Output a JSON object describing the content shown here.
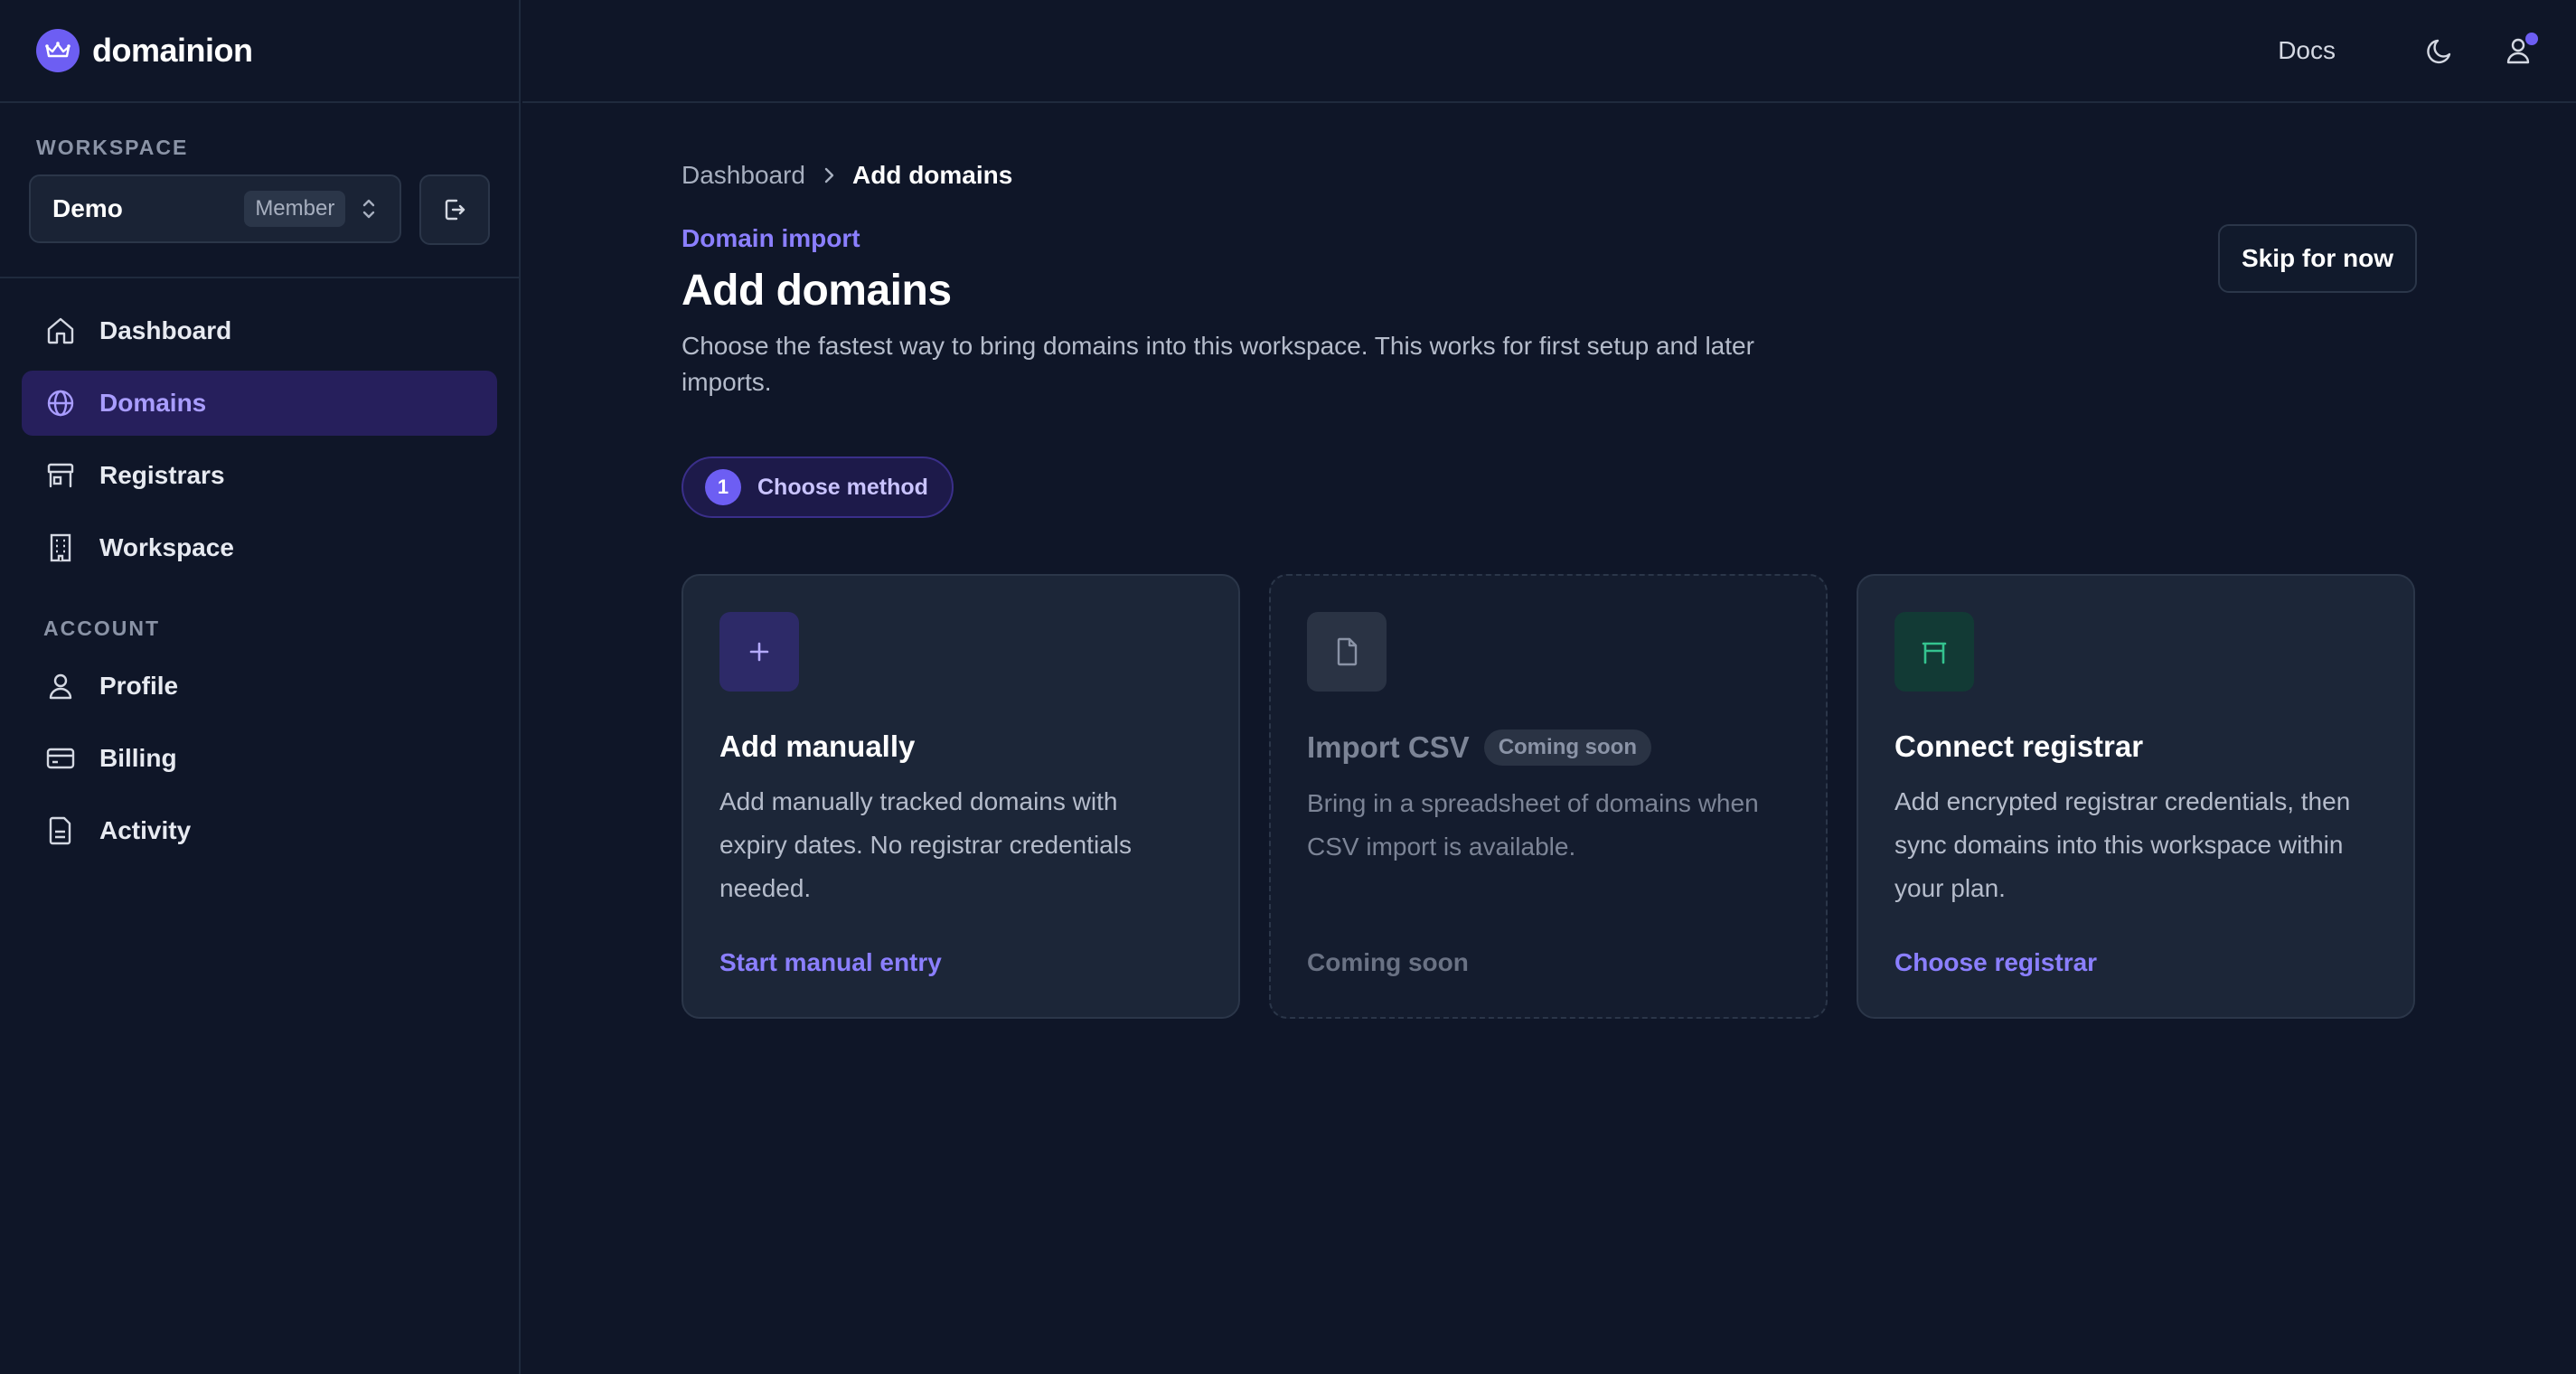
{
  "brand": {
    "name": "domainion"
  },
  "topbar": {
    "docs_label": "Docs"
  },
  "workspace": {
    "section_label": "WORKSPACE",
    "name": "Demo",
    "role": "Member"
  },
  "nav": {
    "items": [
      {
        "label": "Dashboard",
        "icon": "home-icon"
      },
      {
        "label": "Domains",
        "icon": "globe-icon",
        "active": true
      },
      {
        "label": "Registrars",
        "icon": "registrar-icon"
      },
      {
        "label": "Workspace",
        "icon": "building-icon"
      }
    ],
    "account_label": "ACCOUNT",
    "account_items": [
      {
        "label": "Profile",
        "icon": "user-icon"
      },
      {
        "label": "Billing",
        "icon": "credit-card-icon"
      },
      {
        "label": "Activity",
        "icon": "document-icon"
      }
    ]
  },
  "breadcrumb": {
    "parent": "Dashboard",
    "current": "Add domains"
  },
  "header": {
    "eyebrow": "Domain import",
    "title": "Add domains",
    "description": "Choose the fastest way to bring domains into this workspace. This works for first setup and later imports.",
    "skip_label": "Skip for now"
  },
  "step": {
    "number": "1",
    "label": "Choose method"
  },
  "cards": [
    {
      "title": "Add manually",
      "description": "Add manually tracked domains with expiry dates. No registrar credentials needed.",
      "action": "Start manual entry",
      "icon": "plus-icon"
    },
    {
      "title": "Import CSV",
      "badge": "Coming soon",
      "description": "Bring in a spreadsheet of domains when CSV import is available.",
      "action": "Coming soon",
      "icon": "file-icon",
      "disabled": true
    },
    {
      "title": "Connect registrar",
      "description": "Add encrypted registrar credentials, then sync domains into this workspace within your plan.",
      "action": "Choose registrar",
      "icon": "registrar-icon"
    }
  ],
  "colors": {
    "background": "#0f1628",
    "accent": "#6d5ef3",
    "accent_text": "#8b7fff",
    "registrar_green": "#34c38f"
  }
}
